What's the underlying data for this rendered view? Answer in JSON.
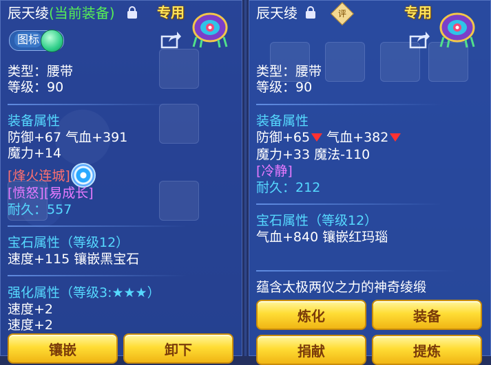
{
  "left": {
    "title_name": "辰天绫",
    "title_tag": "(当前装备)",
    "exclusive": "专用",
    "icon_toggle": "图标",
    "type_line": "类型：腰带",
    "level_line": "等级：90",
    "equip_attr_header": "装备属性",
    "attr_line1": "防御+67 气血+391",
    "attr_line2": "魔力+14",
    "skill": "[烽火连城]",
    "traits": "[愤怒][易成长]",
    "durability_label": "耐久：",
    "durability_value": "557",
    "gem_header": "宝石属性（等级12）",
    "gem_line": "速度+115 镶嵌黑宝石",
    "enhance_header": "强化属性（等级3:★★★）",
    "enhance_line1": "速度+2",
    "enhance_line2": "速度+2",
    "buttons": [
      "镶嵌",
      "卸下"
    ]
  },
  "right": {
    "title_name": "辰天绫",
    "rate_badge": "评",
    "exclusive": "专用",
    "type_line": "类型：腰带",
    "level_line": "等级：90",
    "equip_attr_header": "装备属性",
    "attr_line1_a": "防御+65",
    "attr_line1_b": " 气血+382",
    "attr_line2": "魔力+33 魔法-110",
    "trait": "[冷静]",
    "durability_label": "耐久：",
    "durability_value": "212",
    "gem_header": "宝石属性（等级12）",
    "gem_line": "气血+840 镶嵌红玛瑙",
    "description": "蕴含太极两仪之力的神奇绫缎",
    "buttons": [
      "炼化",
      "装备",
      "捐献",
      "提炼"
    ]
  },
  "colors": {
    "title_tag": "#56ee56",
    "section": "#56d9ff",
    "skill": "#ff7070",
    "trait": "#e77aff",
    "exclusive": "#ffe55a",
    "button": "#ffdd35"
  }
}
